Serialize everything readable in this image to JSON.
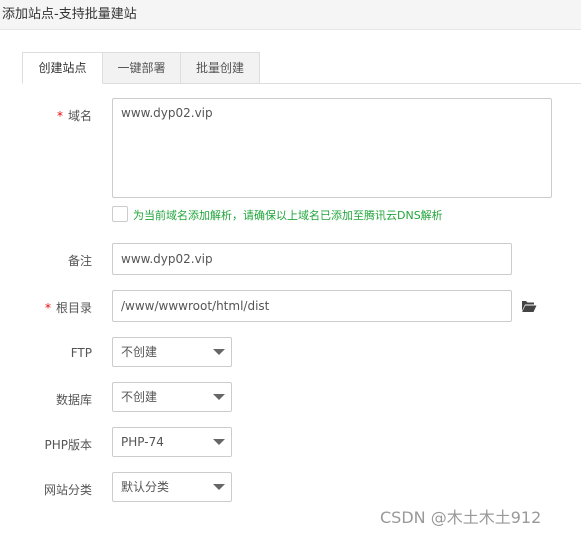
{
  "window": {
    "title": "添加站点-支持批量建站"
  },
  "tabs": [
    {
      "label": "创建站点",
      "active": true
    },
    {
      "label": "一键部署",
      "active": false
    },
    {
      "label": "批量创建",
      "active": false
    }
  ],
  "form": {
    "required_mark": "*",
    "domain": {
      "label": "域名",
      "value": "www.dyp02.vip"
    },
    "dns_checkbox": {
      "label": "为当前域名添加解析，请确保以上域名已添加至腾讯云DNS解析",
      "checked": false
    },
    "remark": {
      "label": "备注",
      "value": "www.dyp02.vip"
    },
    "root_dir": {
      "label": "根目录",
      "value": "/www/wwwroot/html/dist"
    },
    "ftp": {
      "label": "FTP",
      "value": "不创建"
    },
    "database": {
      "label": "数据库",
      "value": "不创建"
    },
    "php_version": {
      "label": "PHP版本",
      "value": "PHP-74"
    },
    "site_category": {
      "label": "网站分类",
      "value": "默认分类"
    }
  },
  "watermark": "CSDN @木土木土912",
  "colors": {
    "required": "#ef0808",
    "hint_green": "#20a53a",
    "folder_icon": "#444444"
  },
  "icons": {
    "folder": "folder-open-icon",
    "caret": "chevron-down-icon"
  }
}
